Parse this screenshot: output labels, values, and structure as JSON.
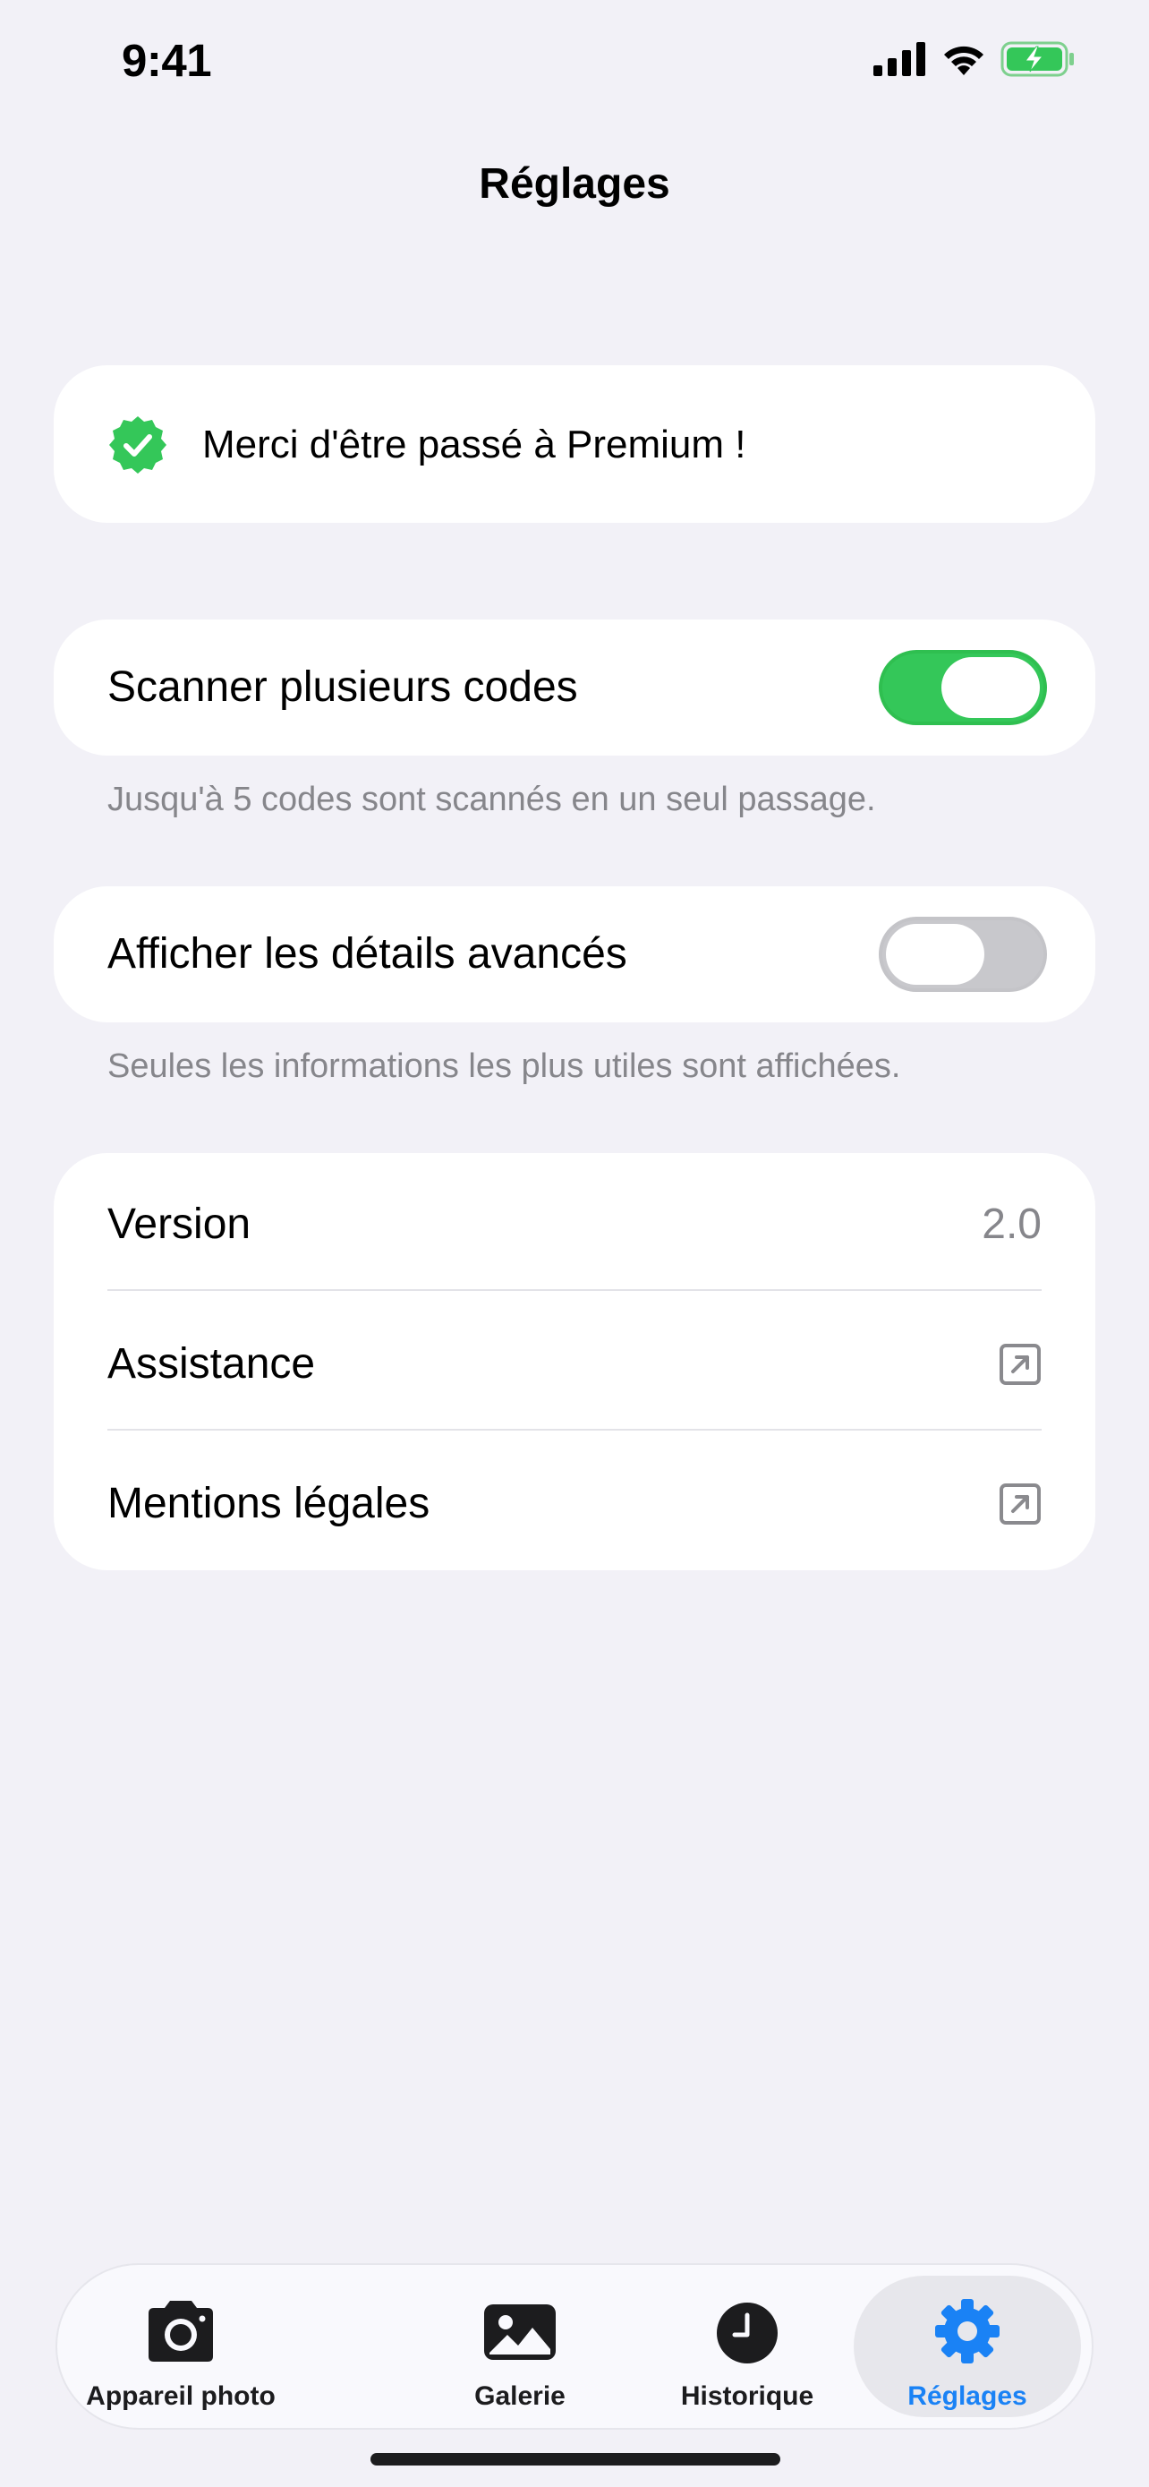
{
  "status_bar": {
    "time": "9:41",
    "icons": [
      "cellular-signal-icon",
      "wifi-icon",
      "battery-charging-icon"
    ]
  },
  "nav": {
    "title": "Réglages"
  },
  "premium": {
    "icon": "verified-badge-icon",
    "text": "Merci d'être passé à Premium !"
  },
  "settings": {
    "multi_scan": {
      "label": "Scanner plusieurs codes",
      "enabled": true,
      "footnote": "Jusqu'à 5 codes sont scannés en un seul passage."
    },
    "advanced_details": {
      "label": "Afficher les détails avancés",
      "enabled": false,
      "footnote": "Seules les informations les plus utiles sont affichées."
    }
  },
  "info_list": {
    "version": {
      "label": "Version",
      "value": "2.0"
    },
    "support": {
      "label": "Assistance",
      "icon": "external-link-icon"
    },
    "legal": {
      "label": "Mentions légales",
      "icon": "external-link-icon"
    }
  },
  "tab_bar": {
    "tabs": [
      {
        "label": "Appareil photo",
        "icon": "camera-icon",
        "active": false
      },
      {
        "label": "Galerie",
        "icon": "photo-gallery-icon",
        "active": false
      },
      {
        "label": "Historique",
        "icon": "clock-icon",
        "active": false
      },
      {
        "label": "Réglages",
        "icon": "gear-icon",
        "active": true
      }
    ]
  },
  "colors": {
    "background": "#f2f1f7",
    "accent_green": "#34c759",
    "accent_blue": "#1a82f5",
    "secondary_text": "#86868b"
  }
}
